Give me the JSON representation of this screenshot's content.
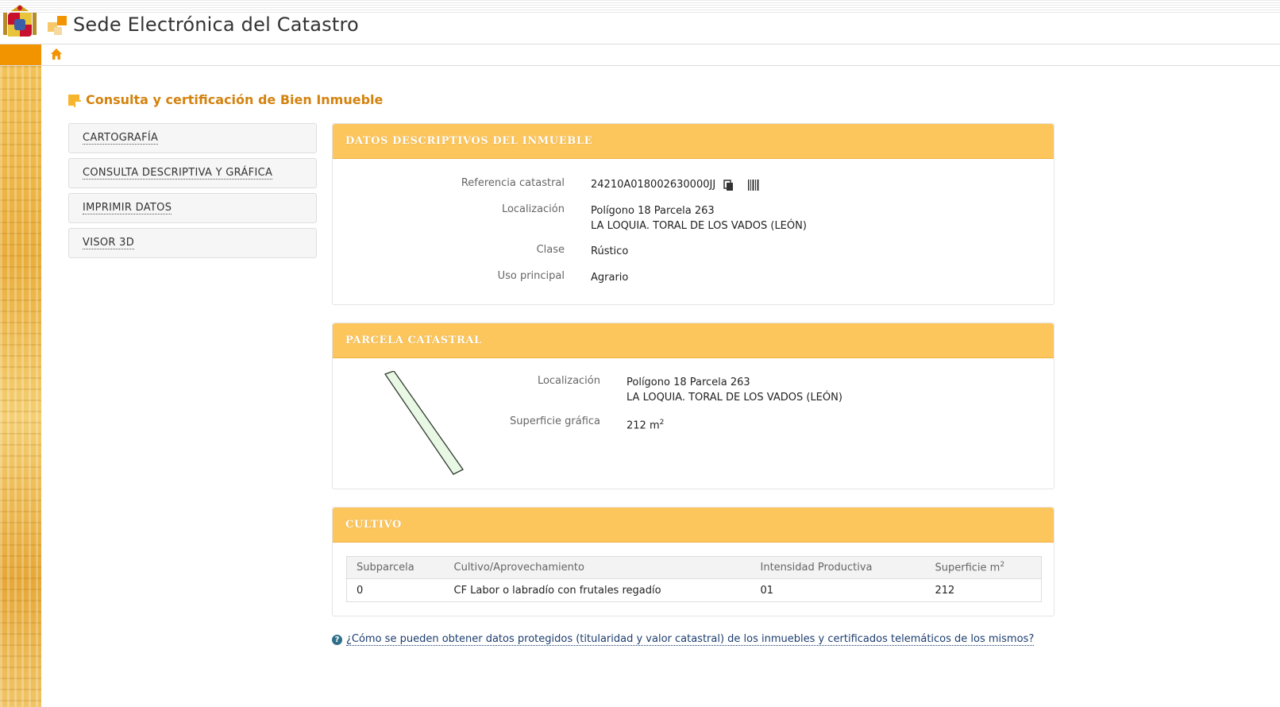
{
  "header": {
    "site_title": "Sede Electrónica del Catastro",
    "shield_icon": "spain-coat-of-arms",
    "logo_icon": "catastro-logo-icon"
  },
  "nav": {
    "home_icon": "home-icon"
  },
  "colors": {
    "accent": "#f29400",
    "panel_header": "#fcc65c",
    "title": "#d4820e"
  },
  "page": {
    "title": "Consulta y certificación de Bien Inmueble"
  },
  "menu": {
    "items": [
      {
        "label": "CARTOGRAFÍA"
      },
      {
        "label": "CONSULTA DESCRIPTIVA Y GRÁFICA"
      },
      {
        "label": "IMPRIMIR DATOS"
      },
      {
        "label": "VISOR 3D"
      }
    ]
  },
  "descriptivos": {
    "header": "DATOS DESCRIPTIVOS DEL INMUEBLE",
    "ref_label": "Referencia catastral",
    "ref_value": "24210A018002630000JJ",
    "loc_label": "Localización",
    "loc_line1": "Polígono 18 Parcela 263",
    "loc_line2": "LA LOQUIA. TORAL DE LOS VADOS (LEÓN)",
    "clase_label": "Clase",
    "clase_value": "Rústico",
    "uso_label": "Uso principal",
    "uso_value": "Agrario",
    "copy_icon": "copy-icon",
    "barcode_icon": "barcode-icon"
  },
  "parcela": {
    "header": "PARCELA CATASTRAL",
    "loc_label": "Localización",
    "loc_line1": "Polígono 18 Parcela 263",
    "loc_line2": "LA LOQUIA. TORAL DE LOS VADOS (LEÓN)",
    "sup_label": "Superficie gráfica",
    "sup_value": "212 m",
    "sup_unit_exp": "2"
  },
  "cultivo": {
    "header": "CULTIVO",
    "columns": [
      "Subparcela",
      "Cultivo/Aprovechamiento",
      "Intensidad Productiva",
      "Superficie m"
    ],
    "sup_exp": "2",
    "rows": [
      [
        "0",
        "CF Labor o labradío con frutales regadío",
        "01",
        "212"
      ]
    ]
  },
  "help": {
    "icon": "question-icon",
    "text": "¿Cómo se pueden obtener datos protegidos (titularidad y valor catastral) de los inmuebles y certificados telemáticos de los mismos?"
  }
}
